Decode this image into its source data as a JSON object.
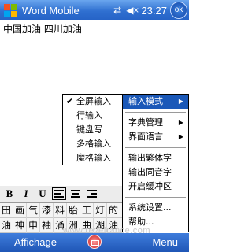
{
  "titlebar": {
    "title": "Word Mobile",
    "connectivity": "⇄",
    "volume": "◀×",
    "time": "23:27",
    "ok_label": "ok",
    "start_icon": "windows-flag-icon"
  },
  "document": {
    "text": "中国加油  四川加油"
  },
  "input_menu": {
    "items": [
      {
        "label": "全屏输入",
        "checked": true
      },
      {
        "label": "行输入",
        "checked": false
      },
      {
        "label": "键盘写",
        "checked": false
      },
      {
        "label": "多格输入",
        "checked": false
      },
      {
        "label": "魔格输入",
        "checked": false
      }
    ],
    "check_mark": "✔"
  },
  "main_menu": {
    "items": [
      {
        "label": "输入模式",
        "submenu": true,
        "highlighted": true
      },
      {
        "separator": true
      },
      {
        "label": "字典管理",
        "submenu": true
      },
      {
        "label": "界面语言",
        "submenu": true
      },
      {
        "separator": true
      },
      {
        "label": "输出繁体字"
      },
      {
        "label": "输出同音字"
      },
      {
        "label": "开启缓冲区"
      },
      {
        "separator": true
      },
      {
        "label": "系统设置..."
      },
      {
        "label": "帮助..."
      }
    ],
    "arrow": "▶"
  },
  "format_toolbar": {
    "bold": "B",
    "italic": "I",
    "underline": "U"
  },
  "candidates": {
    "row1": [
      "田",
      "画",
      "气",
      "漆",
      "料",
      "胎",
      "工",
      "灯",
      "的"
    ],
    "row2": [
      "油",
      "神",
      "申",
      "袖",
      "涌",
      "洲",
      "曲",
      "湖",
      "油"
    ]
  },
  "watermark": "www.revefrance.com",
  "softkeys": {
    "left": "Affichage",
    "right": "Menu"
  },
  "colors": {
    "titlebar": "#2f6fd0",
    "highlight": "#1a58b8"
  }
}
